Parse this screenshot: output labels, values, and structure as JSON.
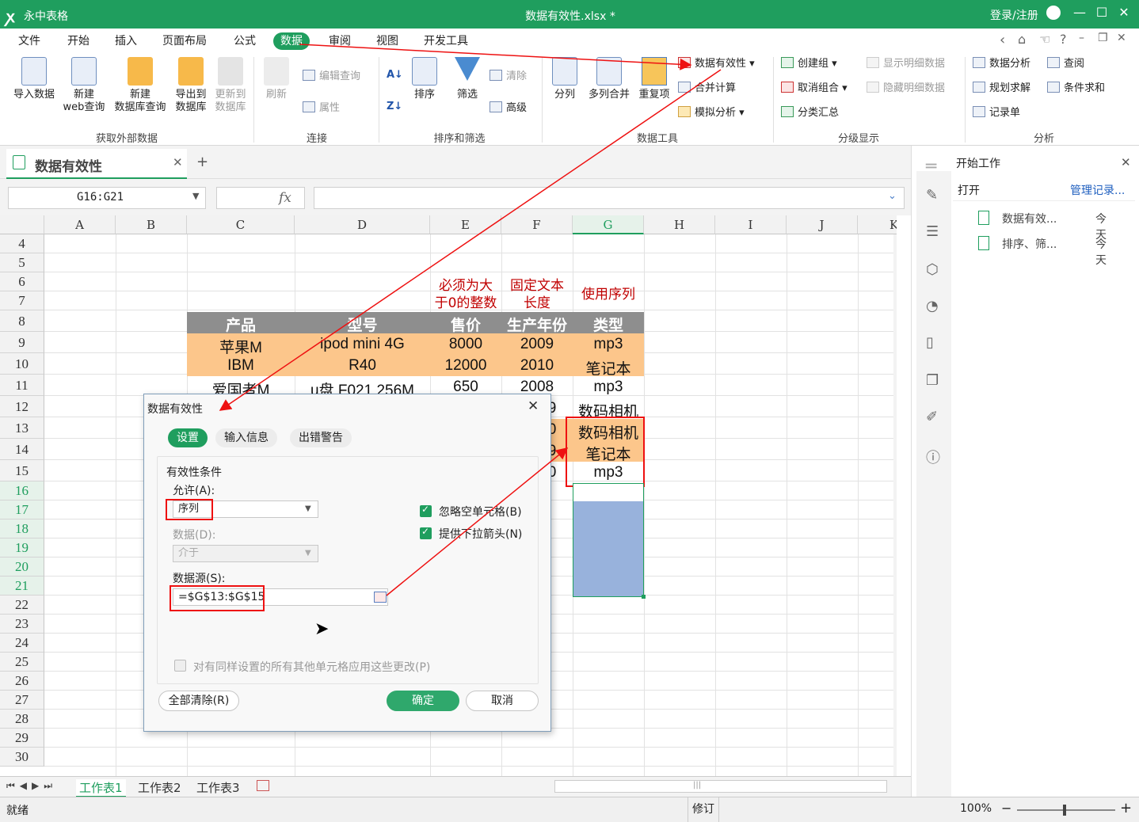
{
  "titlebar": {
    "app_name": "永中表格",
    "doc_title": "数据有效性.xlsx *",
    "login": "登录/注册",
    "min": "—",
    "max": "☐",
    "close": "✕"
  },
  "menu": [
    "文件",
    "开始",
    "插入",
    "页面布局",
    "公式",
    "数据",
    "审阅",
    "视图",
    "开发工具"
  ],
  "menu_active": "数据",
  "ribbon": {
    "get_external": {
      "import": "导入数据",
      "web_1": "新建",
      "web_2": "web查询",
      "dbq_1": "新建",
      "dbq_2": "数据库查询",
      "export_1": "导出到",
      "export_2": "数据库",
      "update_1": "更新到",
      "update_2": "数据库",
      "group": "获取外部数据"
    },
    "connect": {
      "refresh": "刷新",
      "edit_query": "编辑查询",
      "properties": "属性",
      "group": "连接"
    },
    "sort_filter": {
      "sort": "排序",
      "filter": "筛选",
      "clear": "清除",
      "advanced": "高级",
      "group": "排序和筛选"
    },
    "data_tools": {
      "split": "分列",
      "merge": "多列合并",
      "duplicate": "重复项",
      "validation": "数据有效性",
      "consolidate": "合并计算",
      "whatif": "模拟分析",
      "group": "数据工具"
    },
    "outline": {
      "group_create": "创建组",
      "ungroup": "取消组合",
      "subtotal": "分类汇总",
      "show_detail": "显示明细数据",
      "hide_detail": "隐藏明细数据",
      "group": "分级显示"
    },
    "analysis": {
      "data_analysis": "数据分析",
      "lookup": "查阅",
      "solver": "规划求解",
      "cond_sum": "条件求和",
      "form": "记录单",
      "group": "分析"
    }
  },
  "doc_tab": {
    "name": "数据有效性",
    "add": "+"
  },
  "formula_bar": {
    "name_box": "G16:G21",
    "fx": "fx"
  },
  "columns": [
    "A",
    "B",
    "C",
    "D",
    "E",
    "F",
    "G",
    "H",
    "I",
    "J",
    "K"
  ],
  "rows": [
    "4",
    "5",
    "6",
    "7",
    "8",
    "9",
    "10",
    "11",
    "12",
    "13",
    "14",
    "15",
    "16",
    "17",
    "18",
    "19",
    "20",
    "21",
    "22",
    "23",
    "24",
    "25",
    "26",
    "27",
    "28",
    "29",
    "30"
  ],
  "notes": {
    "e": [
      "必须为大",
      "于0的整数"
    ],
    "f": [
      "固定文本",
      "长度"
    ],
    "g": "使用序列"
  },
  "table": {
    "headers": [
      "产品",
      "型号",
      "售价",
      "生产年份",
      "类型"
    ],
    "rows": [
      [
        "苹果M",
        "ipod mini 4G",
        "8000",
        "2009",
        "mp3"
      ],
      [
        "IBM",
        "R40",
        "12000",
        "2010",
        "笔记本"
      ],
      [
        "爱国者M",
        "u盘 F021 256M",
        "650",
        "2008",
        "mp3"
      ]
    ],
    "partial_f": [
      "9",
      "0",
      "9",
      "0"
    ],
    "g_extra": [
      "数码相机",
      "数码相机",
      "笔记本",
      "mp3"
    ]
  },
  "sheets": [
    "工作表1",
    "工作表2",
    "工作表3"
  ],
  "status": {
    "ready": "就绪",
    "mode": "修订",
    "zoom": "100%",
    "minus": "−",
    "plus": "+"
  },
  "taskpane": {
    "title": "开始工作",
    "open": "打开",
    "manage": "管理记录...",
    "files": [
      {
        "name": "数据有效...",
        "date": "今天"
      },
      {
        "name": "排序、筛...",
        "date": "今天"
      }
    ]
  },
  "dialog": {
    "title": "数据有效性",
    "tabs": [
      "设置",
      "输入信息",
      "出错警告"
    ],
    "section": "有效性条件",
    "allow_label": "允许(A):",
    "allow_value": "序列",
    "data_label": "数据(D):",
    "data_value": "介于",
    "ignore_blank": "忽略空单元格(B)",
    "dropdown": "提供下拉箭头(N)",
    "source_label": "数据源(S):",
    "source_value": "=$G$13:$G$15",
    "apply_all": "对有同样设置的所有其他单元格应用这些更改(P)",
    "clear_all": "全部清除(R)",
    "ok": "确定",
    "cancel": "取消"
  }
}
